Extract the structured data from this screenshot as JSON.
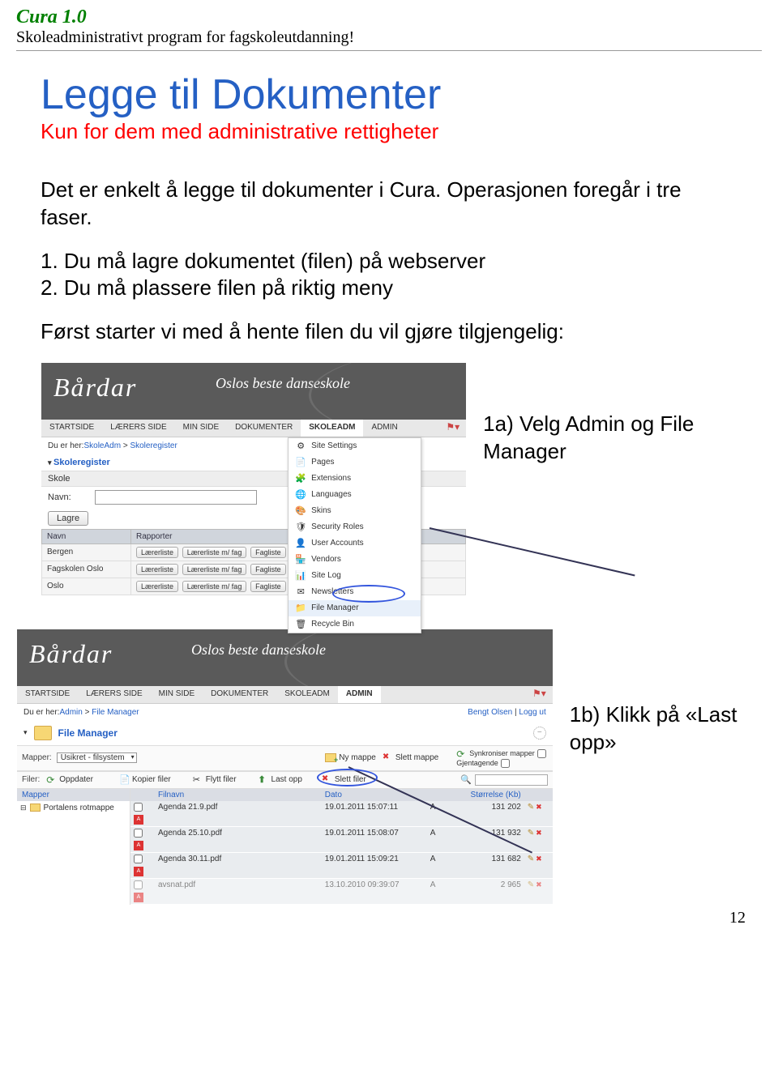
{
  "header": {
    "title": "Cura 1.0",
    "subtitle": "Skoleadministrativt program for fagskoleutdanning!"
  },
  "main": {
    "title": "Legge til Dokumenter",
    "subtitle": "Kun for dem med administrative rettigheter",
    "para1": "Det er enkelt å legge til dokumenter i Cura.  Operasjonen foregår i tre faser.",
    "step1": "1. Du må lagre dokumentet (filen) på webserver",
    "step2": "2. Du må plassere filen på riktig meny",
    "para2": "Først starter vi med å hente filen du vil gjøre tilgjengelig:"
  },
  "annotation1": "1a) Velg Admin og File Manager",
  "annotation2": "1b) Klikk på «Last opp»",
  "ss1": {
    "logo": "Bårdar",
    "logo_sub": "Oslos beste danseskole",
    "tabs": [
      "STARTSIDE",
      "LÆRERS SIDE",
      "MIN SIDE",
      "DOKUMENTER",
      "SKOLEADM",
      "ADMIN"
    ],
    "active_tab": "SKOLEADM",
    "breadcrumb_label": "Du er her: ",
    "breadcrumb_links": [
      "SkoleAdm",
      "Skoleregister"
    ],
    "section_title": "Skoleregister",
    "section_bar": "Skole",
    "form_label": "Navn:",
    "btn_lagre": "Lagre",
    "table_headers": [
      "Navn",
      "Rapporter"
    ],
    "rows": [
      {
        "name": "Bergen",
        "btns": [
          "Lærerliste",
          "Lærerliste m/ fag",
          "Fagliste"
        ]
      },
      {
        "name": "Fagskolen Oslo",
        "btns": [
          "Lærerliste",
          "Lærerliste m/ fag",
          "Fagliste"
        ]
      },
      {
        "name": "Oslo",
        "btns": [
          "Lærerliste",
          "Lærerliste m/ fag",
          "Fagliste"
        ]
      }
    ],
    "admin_menu": [
      {
        "icon": "⚙",
        "label": "Site Settings",
        "color": "#888"
      },
      {
        "icon": "📄",
        "label": "Pages",
        "color": "#888"
      },
      {
        "icon": "🧩",
        "label": "Extensions",
        "color": "#3a8a3a"
      },
      {
        "icon": "🌐",
        "label": "Languages",
        "color": "#3a8ac4"
      },
      {
        "icon": "🎨",
        "label": "Skins",
        "color": "#c48a3a"
      },
      {
        "icon": "🛡",
        "label": "Security Roles",
        "color": "#3a8ac4"
      },
      {
        "icon": "👤",
        "label": "User Accounts",
        "color": "#3a8ac4"
      },
      {
        "icon": "🏪",
        "label": "Vendors",
        "color": "#c48a3a"
      },
      {
        "icon": "📊",
        "label": "Site Log",
        "color": "#888"
      },
      {
        "icon": "✉",
        "label": "Newsletters",
        "color": "#c4aa3a"
      },
      {
        "icon": "📁",
        "label": "File Manager",
        "color": "#c48a3a"
      },
      {
        "icon": "🗑",
        "label": "Recycle Bin",
        "color": "#888"
      }
    ]
  },
  "ss2": {
    "logo": "Bårdar",
    "logo_sub": "Oslos beste danseskole",
    "tabs": [
      "STARTSIDE",
      "LÆRERS SIDE",
      "MIN SIDE",
      "DOKUMENTER",
      "SKOLEADM",
      "ADMIN"
    ],
    "active_tab": "ADMIN",
    "breadcrumb_label": "Du er her: ",
    "breadcrumb_links": [
      "Admin",
      "File Manager"
    ],
    "user_info": "Bengt Olsen",
    "logout": "Logg ut",
    "fm_title": "File Manager",
    "mapper_label": "Mapper:",
    "mapper_value": "Usikret - filsystem",
    "ny_mappe": "Ny mappe",
    "slett_mappe": "Slett mappe",
    "sync": "Synkroniser mapper",
    "recur": "Gjentagende",
    "filer_label": "Filer:",
    "oppdater": "Oppdater",
    "kopier": "Kopier filer",
    "flytt": "Flytt filer",
    "lastopp": "Last opp",
    "slettfiler": "Slett filer",
    "left_header": "Mapper",
    "left_root": "Portalens rotmappe",
    "file_headers": [
      "Filnavn",
      "Dato",
      "",
      "Størrelse (Kb)"
    ],
    "files": [
      {
        "name": "Agenda 21.9.pdf",
        "date": "19.01.2011 15:07:11",
        "a": "A",
        "size": "131 202"
      },
      {
        "name": "Agenda 25.10.pdf",
        "date": "19.01.2011 15:08:07",
        "a": "A",
        "size": "131 932"
      },
      {
        "name": "Agenda 30.11.pdf",
        "date": "19.01.2011 15:09:21",
        "a": "A",
        "size": "131 682"
      },
      {
        "name": "avsnat.pdf",
        "date": "13.10.2010 09:39:07",
        "a": "A",
        "size": "2 965"
      }
    ]
  },
  "page_number": "12"
}
